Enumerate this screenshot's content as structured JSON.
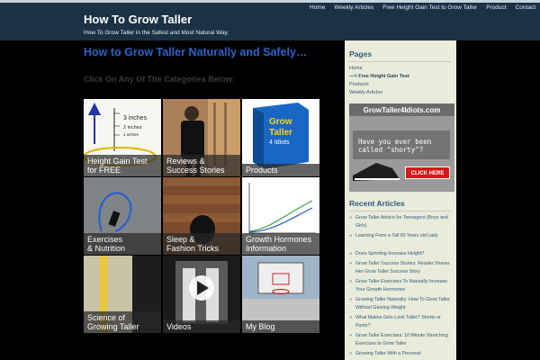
{
  "header": {
    "site_title": "How To Grow Taller",
    "site_description": "How To Grow Taller in the Safest and Most Natural Way."
  },
  "nav": {
    "items": [
      {
        "label": "Home"
      },
      {
        "label": "Weekly Articles"
      },
      {
        "label": "Free Height Gain Test to Grow Taller"
      },
      {
        "label": "Product"
      },
      {
        "label": "Contact"
      }
    ]
  },
  "main": {
    "title": "How to Grow Taller Naturally and Safely…",
    "categories_heading": "Click On Any Of The Categories Below:",
    "tiles": [
      {
        "line1": "Height Gain Test",
        "line2": "for FREE",
        "image_text": [
          "3 inches",
          "2 inches",
          "1 inches"
        ]
      },
      {
        "line1": "Reviews &",
        "line2": "Success Stories"
      },
      {
        "line1": "Products",
        "line2": "",
        "image_text": [
          "Grow",
          "Taller",
          "4 Idiots"
        ]
      },
      {
        "line1": "Exercises",
        "line2": "& Nutrition"
      },
      {
        "line1": "Sleep &",
        "line2": "Fashion Tricks"
      },
      {
        "line1": "Growth Hormones",
        "line2": "Information"
      },
      {
        "line1": "Science of",
        "line2": "Growing Taller"
      },
      {
        "line1": "Videos",
        "line2": ""
      },
      {
        "line1": "My Blog",
        "line2": ""
      }
    ]
  },
  "sidebar": {
    "pages_heading": "Pages",
    "pages": [
      {
        "label": "Home"
      },
      {
        "label": "—> Free Height Gain Test"
      },
      {
        "label": "Products"
      },
      {
        "label": "Weekly Articles"
      }
    ],
    "ad": {
      "site": "GrowTaller4Idiots.com",
      "headline": "Have you ever been called \"shorty\"?",
      "button": "CLICK HERE"
    },
    "recent_heading": "Recent Articles",
    "recent": [
      {
        "label": "Grow Taller Advice for Teenagers (Boys and Girls)"
      },
      {
        "label": "Learning From a Tall 90 Years old Lady"
      },
      {
        "label": "Does Sprinting Increase Height?"
      },
      {
        "label": "Grow Taller Success Stories: Reader Shares Her Grow Taller Success Story"
      },
      {
        "label": "Grow Taller Exercises To Naturally Increase Your Growth Hormones"
      },
      {
        "label": "Growing Taller Naturally: How To Grow Taller Without Gaining Weight"
      },
      {
        "label": "What Makes Girls Look Taller? Shorts or Pants?"
      },
      {
        "label": "Grow Taller Exercises: 10 Minute Stretching Exercises to Grow Taller"
      },
      {
        "label": "Growing Taller With a Personal"
      }
    ]
  }
}
